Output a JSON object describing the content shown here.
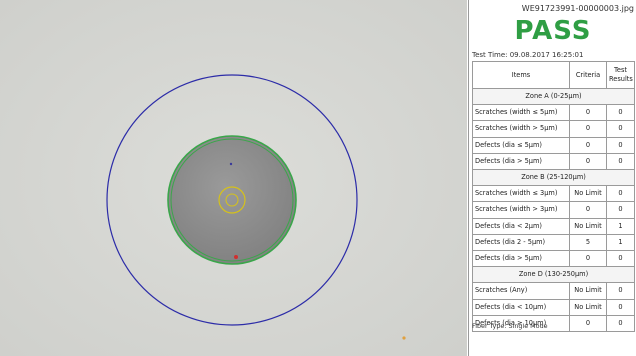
{
  "file_name": "WE91723991-00000003.jpg",
  "result": "PASS",
  "test_time": "Test Time: 09.08.2017 16:25:01",
  "columns": {
    "items": "Items",
    "criteria": "Criteria",
    "results": "Test Results"
  },
  "zones": [
    {
      "name": "Zone A (0-25µm)",
      "rows": [
        {
          "item": "Scratches (width ≤ 5µm)",
          "criteria": "0",
          "result": "0"
        },
        {
          "item": "Scratches (width > 5µm)",
          "criteria": "0",
          "result": "0"
        },
        {
          "item": "Defects (dia ≤ 5µm)",
          "criteria": "0",
          "result": "0"
        },
        {
          "item": "Defects (dia > 5µm)",
          "criteria": "0",
          "result": "0"
        }
      ]
    },
    {
      "name": "Zone B (25-120µm)",
      "rows": [
        {
          "item": "Scratches (width ≤ 3µm)",
          "criteria": "No Limit",
          "result": "0"
        },
        {
          "item": "Scratches (width > 3µm)",
          "criteria": "0",
          "result": "0"
        },
        {
          "item": "Defects (dia < 2µm)",
          "criteria": "No Limit",
          "result": "1"
        },
        {
          "item": "Defects (dia 2 - 5µm)",
          "criteria": "5",
          "result": "1"
        },
        {
          "item": "Defects (dia > 5µm)",
          "criteria": "0",
          "result": "0"
        }
      ]
    },
    {
      "name": "Zone D (130-250µm)",
      "rows": [
        {
          "item": "Scratches (Any)",
          "criteria": "No Limit",
          "result": "0"
        },
        {
          "item": "Defects (dia < 10µm)",
          "criteria": "No Limit",
          "result": "0"
        },
        {
          "item": "Defects (dia ≥ 10µm)",
          "criteria": "0",
          "result": "0"
        }
      ]
    }
  ],
  "fiber_type": "Fiber Type: Single Mode",
  "colors": {
    "pass": "#2f9e44",
    "outer_ring": "#2c2ca8",
    "cladding_ring": "#3aa64a",
    "core_ring": "#d6c21a",
    "defect_marker": "#d03030",
    "background": "#d6d7d3",
    "core_fill": "#8e8e8e"
  }
}
